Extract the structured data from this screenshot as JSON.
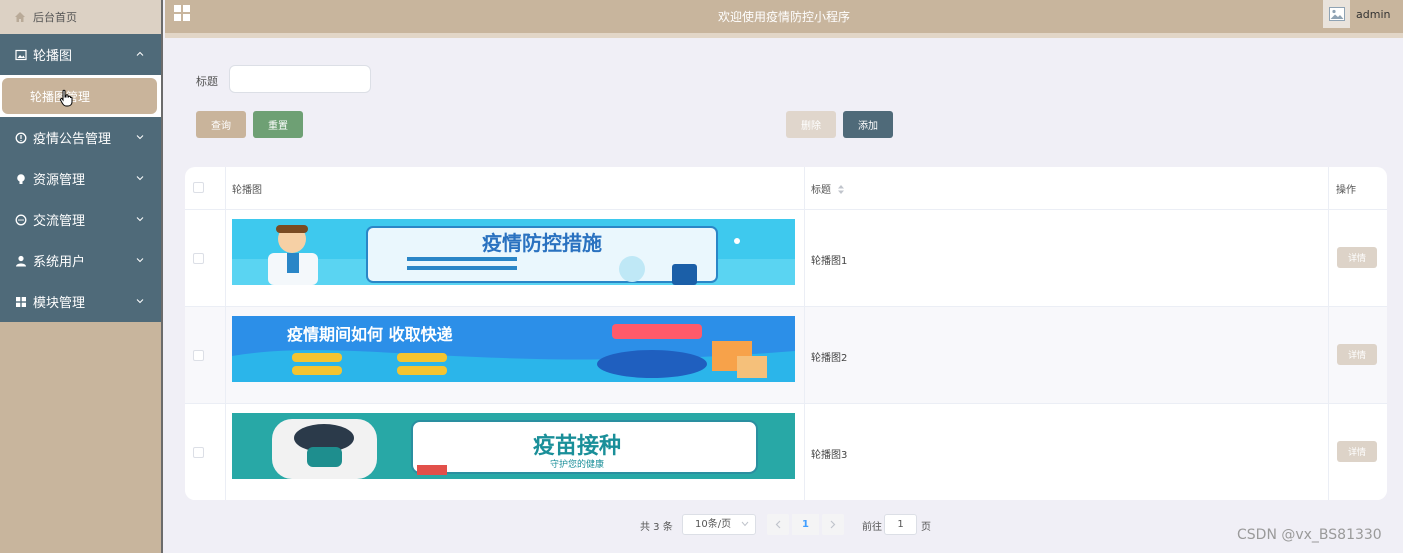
{
  "sidebar": {
    "home_label": "后台首页",
    "menu": [
      {
        "label": "轮播图",
        "icon": "image-icon",
        "expanded": true
      },
      {
        "label": "疫情公告管理",
        "icon": "alert-circle-icon"
      },
      {
        "label": "资源管理",
        "icon": "bulb-icon"
      },
      {
        "label": "交流管理",
        "icon": "chat-icon"
      },
      {
        "label": "系统用户",
        "icon": "user-icon"
      },
      {
        "label": "模块管理",
        "icon": "grid-icon"
      }
    ],
    "submenu": {
      "label": "轮播图管理"
    }
  },
  "header": {
    "title": "欢迎使用疫情防控小程序",
    "user": "admin"
  },
  "search": {
    "title_label": "标题",
    "title_value": "",
    "query_btn": "查询",
    "reset_btn": "重置",
    "delete_btn": "删除",
    "add_btn": "添加"
  },
  "table": {
    "headers": {
      "banner": "轮播图",
      "title": "标题",
      "action": "操作"
    },
    "rows": [
      {
        "title": "轮播图1",
        "detail": "详情",
        "banner_text": "疫情防控措施"
      },
      {
        "title": "轮播图2",
        "detail": "详情",
        "banner_text": "疫情期间如何 收取快递"
      },
      {
        "title": "轮播图3",
        "detail": "详情",
        "banner_text": "疫苗接种",
        "banner_sub": "守护您的健康"
      }
    ]
  },
  "pagination": {
    "total": "共 3 条",
    "page_size": "10条/页",
    "current": "1",
    "goto_label": "前往",
    "goto_value": "1",
    "page_label": "页"
  },
  "watermark": "CSDN @vx_BS81330",
  "colors": {
    "accent": "#c8b59d",
    "sidebar_menu": "#4f6a79",
    "reset_green": "#6ea074",
    "add_dark": "#4f6a79"
  }
}
